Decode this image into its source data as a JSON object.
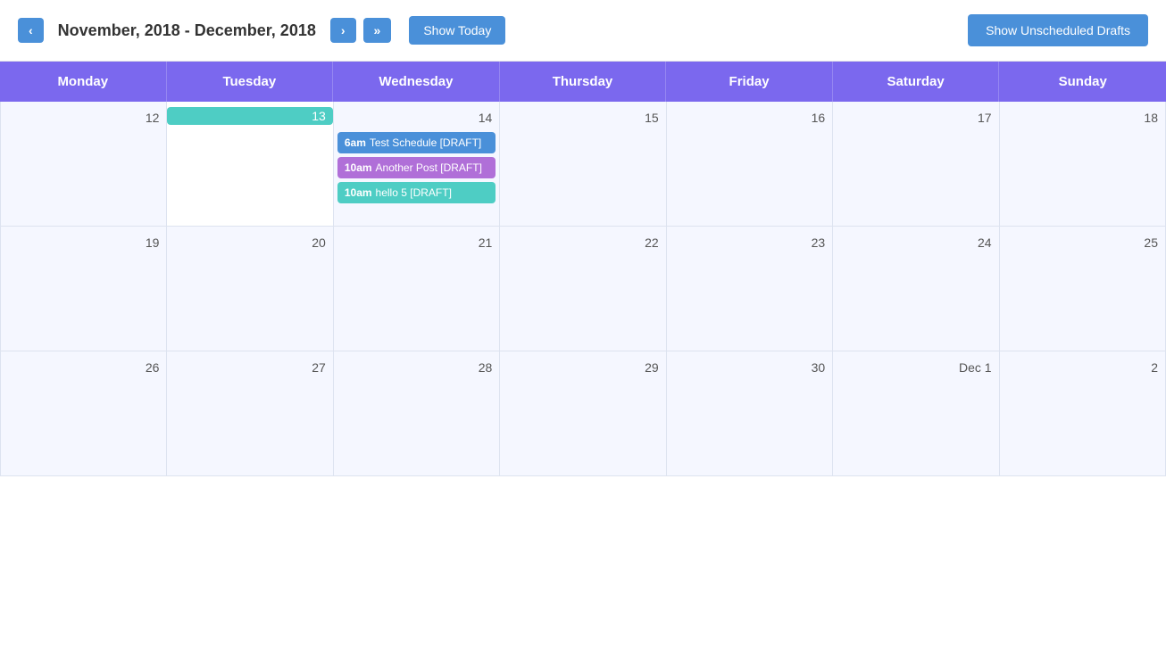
{
  "header": {
    "date_range": "November, 2018 - December, 2018",
    "prev_label": "‹",
    "next_label": "›",
    "next_next_label": "»",
    "show_today_label": "Show Today",
    "show_unscheduled_label": "Show Unscheduled Drafts"
  },
  "calendar": {
    "days": [
      "Monday",
      "Tuesday",
      "Wednesday",
      "Thursday",
      "Friday",
      "Saturday",
      "Sunday"
    ],
    "weeks": [
      {
        "cells": [
          {
            "date": "12",
            "today": false,
            "events": []
          },
          {
            "date": "13",
            "today": true,
            "events": []
          },
          {
            "date": "14",
            "today": false,
            "events": [
              {
                "time": "6am",
                "title": "Test Schedule [DRAFT]",
                "color": "event-blue"
              },
              {
                "time": "10am",
                "title": "Another Post [DRAFT]",
                "color": "event-purple"
              },
              {
                "time": "10am",
                "title": "hello 5 [DRAFT]",
                "color": "event-teal"
              }
            ]
          },
          {
            "date": "15",
            "today": false,
            "events": []
          },
          {
            "date": "16",
            "today": false,
            "events": []
          },
          {
            "date": "17",
            "today": false,
            "events": []
          },
          {
            "date": "18",
            "today": false,
            "events": []
          }
        ]
      },
      {
        "cells": [
          {
            "date": "19",
            "today": false,
            "events": []
          },
          {
            "date": "20",
            "today": false,
            "events": []
          },
          {
            "date": "21",
            "today": false,
            "events": []
          },
          {
            "date": "22",
            "today": false,
            "events": []
          },
          {
            "date": "23",
            "today": false,
            "events": []
          },
          {
            "date": "24",
            "today": false,
            "events": []
          },
          {
            "date": "25",
            "today": false,
            "events": []
          }
        ]
      },
      {
        "cells": [
          {
            "date": "26",
            "today": false,
            "events": []
          },
          {
            "date": "27",
            "today": false,
            "events": []
          },
          {
            "date": "28",
            "today": false,
            "events": []
          },
          {
            "date": "29",
            "today": false,
            "events": []
          },
          {
            "date": "30",
            "today": false,
            "events": []
          },
          {
            "date": "Dec 1",
            "today": false,
            "events": []
          },
          {
            "date": "2",
            "today": false,
            "events": []
          }
        ]
      }
    ]
  }
}
